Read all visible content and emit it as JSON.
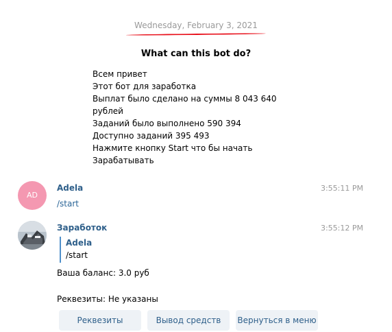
{
  "date_separator": "Wednesday, February 3, 2021",
  "bot_info": {
    "title": "What can this bot do?",
    "lines": [
      "Всем привет",
      "Этот бот для заработка",
      "Выплат было сделано на суммы 8 043 640",
      "рублей",
      "Заданий было выполнено 590 394",
      "Доступно заданий 395 493",
      "Нажмите кнопку Start что бы начать",
      "Зарабатывать"
    ]
  },
  "messages": [
    {
      "avatar_initials": "AD",
      "avatar_color": "#f498b1",
      "author": "Adela",
      "time": "3:55:11 PM",
      "text": "/start"
    },
    {
      "avatar_icon": "bot-photo-avatar",
      "author": "Заработок",
      "time": "3:55:12 PM",
      "reply": {
        "author": "Adela",
        "text": "/start"
      },
      "lines": [
        "Ваша баланс: 3.0 руб",
        "Реквезиты: Не указаны"
      ]
    }
  ],
  "keyboard": [
    "Реквезиты",
    "Вывод средств",
    "Вернуться в меню"
  ],
  "colors": {
    "author": "#2e5f8a",
    "link": "#2a6496",
    "button_bg": "#eef2f6",
    "annotation_red": "#e8101b"
  }
}
